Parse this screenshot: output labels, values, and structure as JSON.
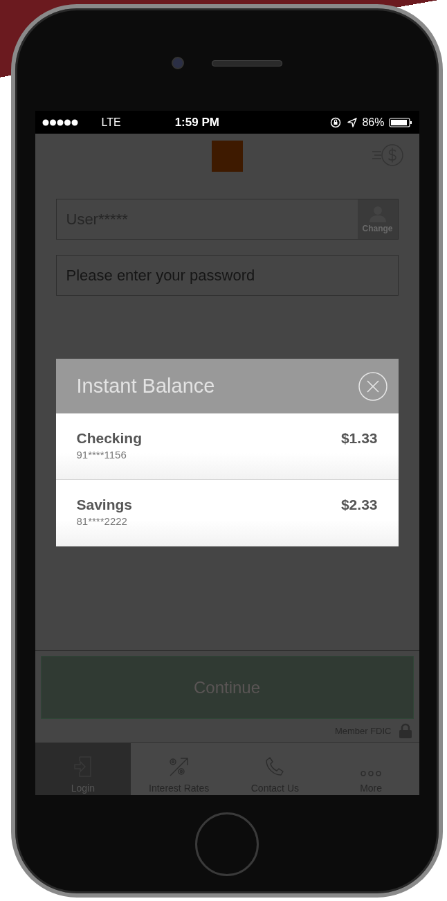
{
  "status_bar": {
    "carrier": "LTE",
    "time": "1:59 PM",
    "battery": "86%"
  },
  "login": {
    "username": "User*****",
    "change_label": "Change",
    "password_placeholder": "Please enter your password"
  },
  "continue_button": {
    "label": "Continue",
    "disabled": true
  },
  "footer": {
    "text": "Member FDIC"
  },
  "modal": {
    "title": "Instant Balance",
    "accounts": [
      {
        "name": "Checking",
        "number": "91****1156",
        "balance": "$1.33"
      },
      {
        "name": "Savings",
        "number": "81****2222",
        "balance": "$2.33"
      }
    ]
  },
  "tabs": [
    {
      "label": "Login",
      "kind": "login",
      "selected": true
    },
    {
      "label": "Interest Rates",
      "kind": "rates",
      "selected": false
    },
    {
      "label": "Contact Us",
      "kind": "contact",
      "selected": false
    },
    {
      "label": "More",
      "kind": "more",
      "selected": false
    }
  ]
}
